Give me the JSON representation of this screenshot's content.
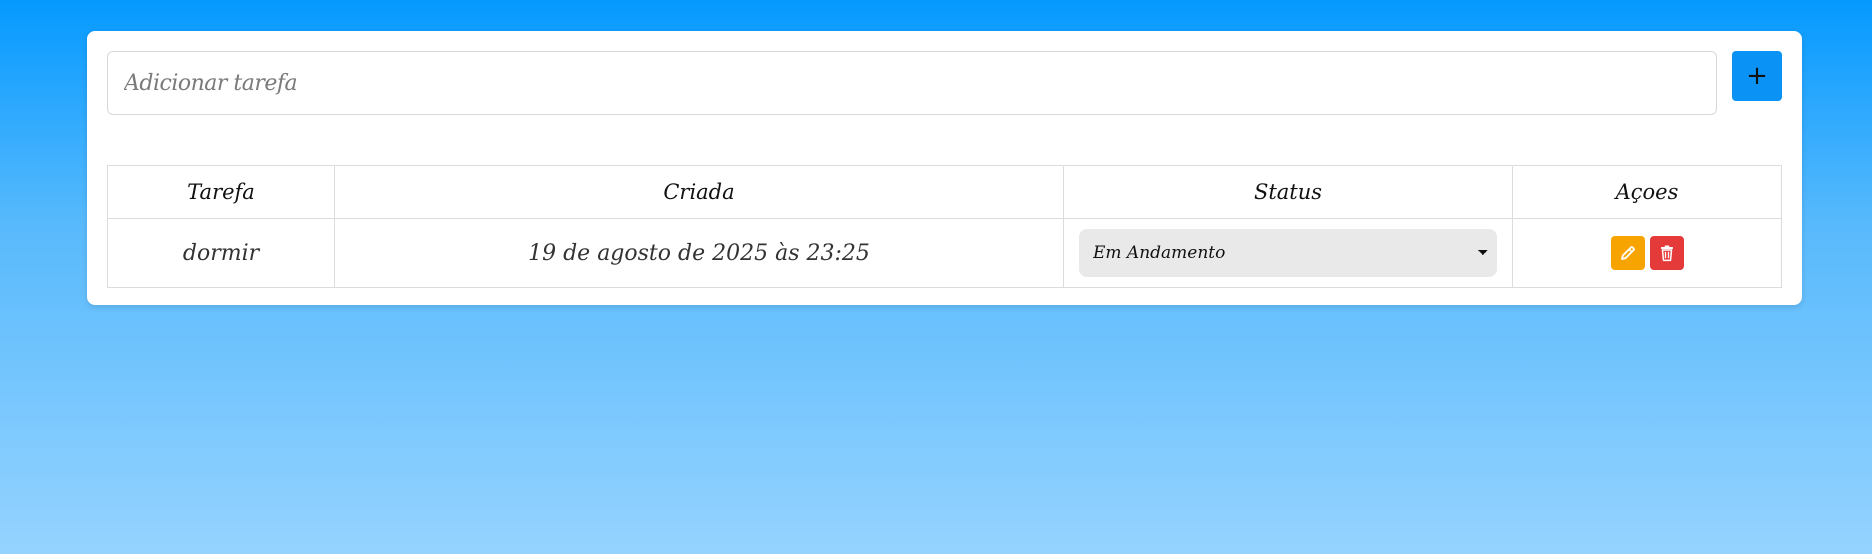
{
  "form": {
    "input_placeholder": "Adicionar tarefa",
    "input_value": "",
    "add_button_label": "+"
  },
  "table": {
    "headers": {
      "task": "Tarefa",
      "created": "Criada",
      "status": "Status",
      "actions": "Açoes"
    },
    "rows": [
      {
        "task": "dormir",
        "created": "19 de agosto de 2025 às 23:25",
        "status": "Em Andamento",
        "edit_icon": "pencil-icon",
        "delete_icon": "trash-icon"
      }
    ]
  },
  "colors": {
    "primary": "#0a93f5",
    "edit": "#f7a400",
    "delete": "#e53a3a"
  }
}
